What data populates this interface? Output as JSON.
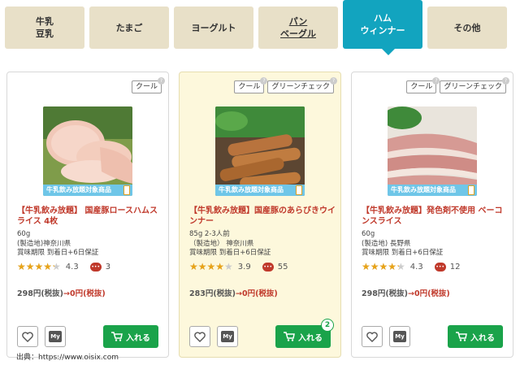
{
  "tabs": [
    {
      "label": "牛乳\n豆乳",
      "active": false
    },
    {
      "label": "たまご",
      "active": false
    },
    {
      "label": "ヨーグルト",
      "active": false
    },
    {
      "label": "パン\nベーグル",
      "active": false
    },
    {
      "label": "ハム\nウィンナー",
      "active": true
    },
    {
      "label": "その他",
      "active": false
    }
  ],
  "promo_band": "牛乳飲み放題対象商品",
  "products": [
    {
      "badges": [
        "クール"
      ],
      "title": "【牛乳飲み放題】 国産豚ロースハムスライス 4枚",
      "info": [
        "60g",
        "(製造地)神奈川県",
        "賞味期限 到着日+6日保証"
      ],
      "rating": 4.3,
      "rating_text": "4.3",
      "comments": "3",
      "price": "298円(税抜)",
      "sale": "→0円(税抜)",
      "add_label": "入れる",
      "cart_count": ""
    },
    {
      "badges": [
        "クール",
        "グリーンチェック"
      ],
      "title": "【牛乳飲み放題】国産豚のあらびきウインナー",
      "info": [
        "85g 2-3人前",
        "（製造地） 神奈川県",
        "賞味期限 到着日+6日保証"
      ],
      "rating": 3.9,
      "rating_text": "3.9",
      "comments": "55",
      "price": "283円(税抜)",
      "sale": "→0円(税抜)",
      "add_label": "入れる",
      "cart_count": "2"
    },
    {
      "badges": [
        "クール",
        "グリーンチェック"
      ],
      "title": "【牛乳飲み放題】発色剤不使用 ベーコンスライス",
      "info": [
        "60g",
        "(製造地) 長野県",
        "賞味期限 到着日+6日保証"
      ],
      "rating": 4.3,
      "rating_text": "4.3",
      "comments": "12",
      "price": "298円(税抜)",
      "sale": "→0円(税抜)",
      "add_label": "入れる",
      "cart_count": ""
    }
  ],
  "my_label": "My",
  "source": "出典：https://www.oisix.com",
  "colors": {
    "accent": "#12a4bf",
    "tab_bg": "#e8e0c8",
    "price_red": "#c0392b",
    "button_green": "#1aa34a",
    "star": "#e8a317"
  }
}
